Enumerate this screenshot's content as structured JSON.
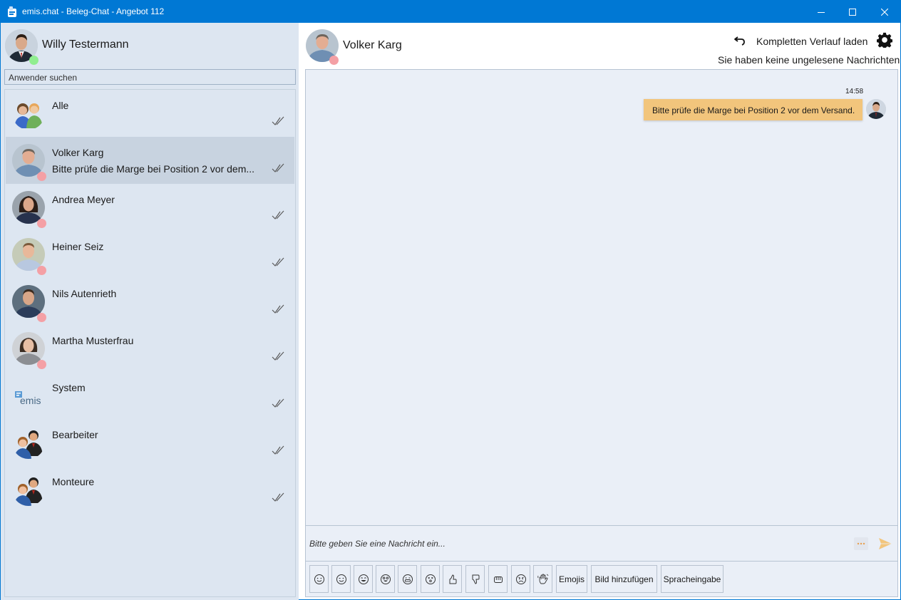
{
  "window": {
    "title": "emis.chat - Beleg-Chat - Angebot 112",
    "accent": "#0078d4"
  },
  "me": {
    "name": "Willy Testermann",
    "status": "online",
    "status_color": "#90ee90"
  },
  "search": {
    "placeholder": "Anwender suchen"
  },
  "contacts": [
    {
      "name": "Alle",
      "preview": "",
      "avatar": "group-icon",
      "status": ""
    },
    {
      "name": "Volker Karg",
      "preview": "Bitte prüfe die Marge bei Position 2 vor dem...",
      "avatar": "photo",
      "status": "offline",
      "selected": true
    },
    {
      "name": "Andrea Meyer",
      "preview": "",
      "avatar": "photo",
      "status": "offline"
    },
    {
      "name": "Heiner Seiz",
      "preview": "",
      "avatar": "photo",
      "status": "offline"
    },
    {
      "name": "Nils Autenrieth",
      "preview": "",
      "avatar": "photo",
      "status": "offline"
    },
    {
      "name": "Martha Musterfrau",
      "preview": "",
      "avatar": "photo",
      "status": "offline"
    },
    {
      "name": "System",
      "preview": "",
      "avatar": "emis-logo",
      "status": ""
    },
    {
      "name": "Bearbeiter",
      "preview": "",
      "avatar": "people-icon",
      "status": ""
    },
    {
      "name": "Monteure",
      "preview": "",
      "avatar": "people-icon",
      "status": ""
    }
  ],
  "system_logo_text": "emis",
  "chat": {
    "partner_name": "Volker Karg",
    "partner_status_color": "#f4a0a5",
    "load_history_label": "Kompletten Verlauf laden",
    "unread_text": "Sie haben keine ungelesene Nachrichten",
    "messages": [
      {
        "time": "14:58",
        "text": "Bitte prüfe die Marge bei Position 2 vor dem Versand.",
        "bubble_color": "#f2c57c"
      }
    ],
    "input_placeholder": "Bitte geben Sie eine Nachricht ein..."
  },
  "toolbar": {
    "emojis": [
      "smile-emoji",
      "wink-emoji",
      "laugh-emoji",
      "crazy-emoji",
      "grin-emoji",
      "dizzy-emoji",
      "thumbs-up-emoji",
      "thumbs-down-emoji",
      "fist-emoji",
      "angry-emoji",
      "wave-emoji"
    ],
    "emojis_label": "Emojis",
    "add_image_label": "Bild hinzufügen",
    "voice_input_label": "Spracheingabe"
  }
}
